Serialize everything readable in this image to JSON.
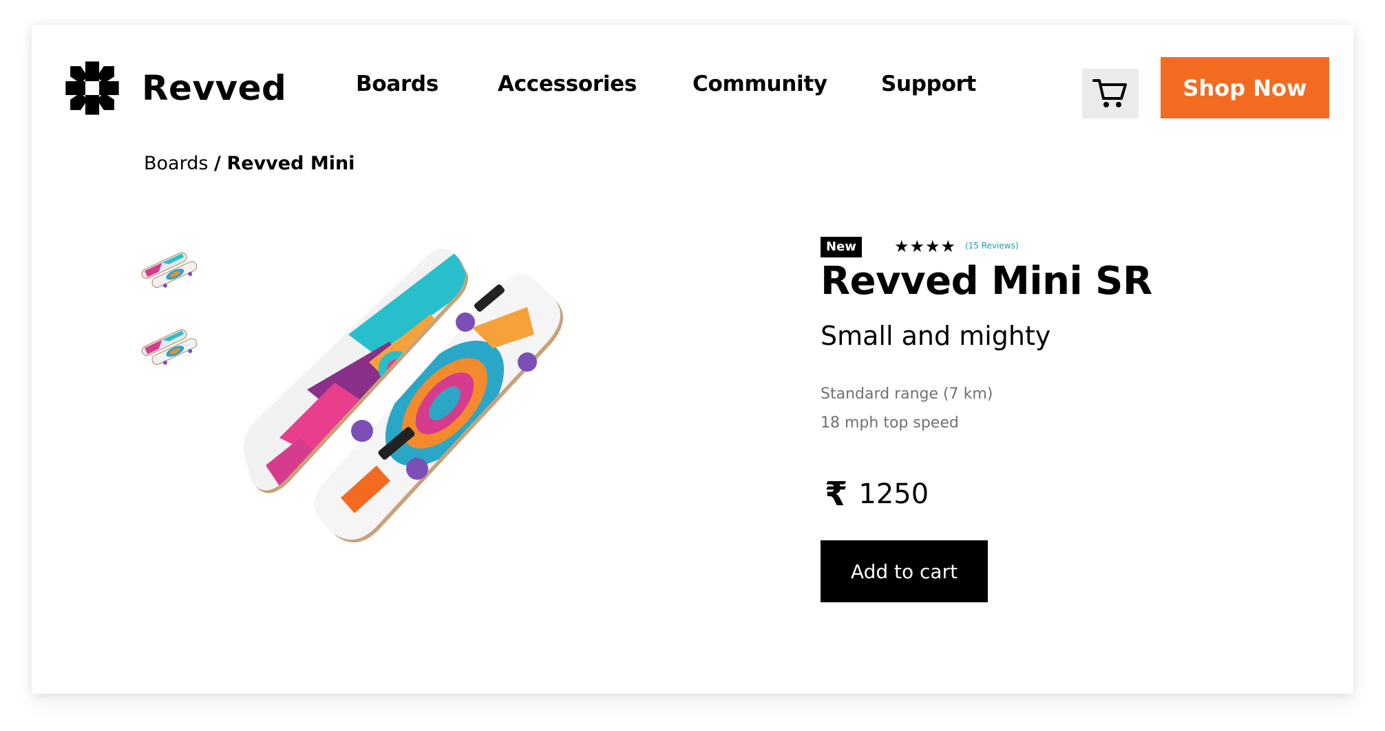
{
  "brand": {
    "name": "Revved",
    "logo_icon": "revved-logo-icon"
  },
  "nav": {
    "items": [
      {
        "label": "Boards"
      },
      {
        "label": "Accessories"
      },
      {
        "label": "Community"
      },
      {
        "label": "Support"
      }
    ],
    "cart_icon": "cart-icon",
    "cta_label": "Shop Now"
  },
  "breadcrumb": {
    "parent": "Boards",
    "separator": "/",
    "current": "Revved Mini"
  },
  "product": {
    "badge": "New",
    "rating": {
      "stars": "★★★★",
      "value": 4,
      "reviews_label": "(15 Reviews)"
    },
    "title": "Revved Mini SR",
    "subtitle": "Small and mighty",
    "specs": [
      "Standard range (7 km)",
      "18 mph top speed"
    ],
    "price": {
      "currency": "₹",
      "amount": "1250"
    },
    "add_to_cart_label": "Add to cart"
  },
  "colors": {
    "accent": "#f36b21",
    "link": "#1a9dac",
    "badge_bg": "#000000",
    "cart_bg": "#ebebeb",
    "spec_text": "#707070"
  }
}
